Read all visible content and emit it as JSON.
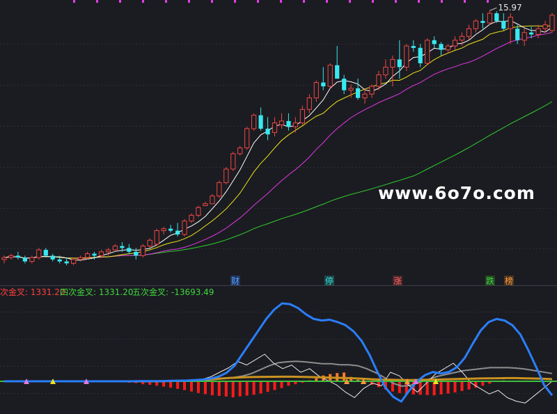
{
  "watermark": "www.6o7o.com",
  "price_panel": {
    "high_label": "15.97",
    "ma_colors": {
      "ma_short": "#ffffff",
      "ma_mid": "#f1e51a",
      "ma_long": "#e337e6",
      "ma_vlong": "#2fd12f"
    },
    "up_color": "#f24645",
    "down_color": "#38e8f0",
    "event_tags": [
      {
        "text": "财",
        "color": "#5aa0ff",
        "bg": "#20345a"
      },
      {
        "text": "停",
        "color": "#3ad8d8",
        "bg": "#1b4a4a"
      },
      {
        "text": "涨",
        "color": "#ff6a6a",
        "bg": "#4a2426"
      },
      {
        "text": "跌",
        "color": "#4bd44b",
        "bg": "#204420"
      },
      {
        "text": "榜",
        "color": "#ff9a3a",
        "bg": "#4a3420"
      }
    ]
  },
  "indicator_panel": {
    "legend": [
      {
        "text": "次金叉: 1331.20",
        "color": "#ff4040"
      },
      {
        "text": "四次金叉: 1331.20",
        "color": "#3fd83f"
      },
      {
        "text": "五次金叉: -13693.49",
        "color": "#3fd83f"
      }
    ]
  },
  "chart_data": {
    "type": "candlestick",
    "grid": true,
    "candles": [
      [
        9.5,
        9.6,
        9.4,
        9.55
      ],
      [
        9.55,
        9.65,
        9.5,
        9.6
      ],
      [
        9.6,
        9.7,
        9.5,
        9.55
      ],
      [
        9.55,
        9.6,
        9.4,
        9.45
      ],
      [
        9.45,
        9.6,
        9.4,
        9.55
      ],
      [
        9.55,
        9.8,
        9.5,
        9.75
      ],
      [
        9.75,
        9.8,
        9.55,
        9.6
      ],
      [
        9.6,
        9.65,
        9.45,
        9.5
      ],
      [
        9.5,
        9.6,
        9.4,
        9.45
      ],
      [
        9.45,
        9.55,
        9.35,
        9.4
      ],
      [
        9.4,
        9.55,
        9.35,
        9.5
      ],
      [
        9.5,
        9.6,
        9.45,
        9.55
      ],
      [
        9.55,
        9.7,
        9.5,
        9.65
      ],
      [
        9.65,
        9.7,
        9.5,
        9.6
      ],
      [
        9.6,
        9.75,
        9.55,
        9.7
      ],
      [
        9.7,
        9.8,
        9.6,
        9.75
      ],
      [
        9.75,
        9.9,
        9.7,
        9.85
      ],
      [
        9.85,
        9.95,
        9.7,
        9.8
      ],
      [
        9.8,
        9.9,
        9.65,
        9.7
      ],
      [
        9.7,
        9.8,
        9.5,
        9.6
      ],
      [
        9.6,
        9.9,
        9.55,
        9.85
      ],
      [
        9.85,
        10.05,
        9.8,
        10.0
      ],
      [
        9.9,
        10.3,
        9.85,
        10.25
      ],
      [
        10.25,
        10.35,
        10.15,
        10.3
      ],
      [
        10.3,
        10.4,
        10.2,
        10.25
      ],
      [
        10.25,
        10.45,
        10.1,
        10.15
      ],
      [
        10.15,
        10.55,
        10.1,
        10.5
      ],
      [
        10.5,
        10.7,
        10.45,
        10.65
      ],
      [
        10.65,
        10.9,
        10.6,
        10.85
      ],
      [
        10.9,
        11.0,
        10.9,
        10.95
      ],
      [
        10.95,
        11.2,
        10.95,
        11.15
      ],
      [
        11.15,
        11.55,
        11.1,
        11.5
      ],
      [
        11.5,
        11.9,
        11.45,
        11.85
      ],
      [
        11.85,
        12.3,
        11.8,
        12.25
      ],
      [
        12.25,
        12.45,
        12.2,
        12.4
      ],
      [
        12.4,
        12.95,
        12.35,
        12.9
      ],
      [
        12.9,
        13.3,
        12.85,
        13.25
      ],
      [
        13.25,
        13.45,
        12.85,
        12.9
      ],
      [
        12.9,
        13.2,
        12.6,
        12.75
      ],
      [
        12.8,
        13.2,
        12.7,
        13.05
      ],
      [
        13.0,
        13.3,
        12.9,
        13.1
      ],
      [
        13.1,
        13.3,
        12.85,
        12.95
      ],
      [
        12.95,
        13.2,
        12.8,
        13.05
      ],
      [
        13.05,
        13.5,
        13.0,
        13.4
      ],
      [
        13.4,
        13.8,
        13.3,
        13.7
      ],
      [
        13.7,
        14.15,
        13.6,
        14.1
      ],
      [
        14.1,
        14.5,
        13.9,
        14.0
      ],
      [
        14.0,
        14.6,
        13.95,
        14.55
      ],
      [
        14.55,
        15.05,
        14.5,
        14.2
      ],
      [
        14.2,
        14.3,
        13.8,
        13.9
      ],
      [
        13.9,
        14.05,
        13.7,
        13.95
      ],
      [
        13.95,
        14.2,
        13.65,
        13.7
      ],
      [
        13.7,
        13.95,
        13.55,
        13.8
      ],
      [
        13.8,
        14.05,
        13.7,
        14.0
      ],
      [
        14.0,
        14.4,
        13.9,
        14.3
      ],
      [
        14.3,
        14.7,
        14.2,
        14.5
      ],
      [
        14.5,
        14.8,
        14.0,
        14.7
      ],
      [
        14.7,
        15.2,
        14.2,
        14.5
      ],
      [
        14.5,
        15.1,
        14.4,
        15.05
      ],
      [
        15.05,
        15.2,
        14.9,
        15.0
      ],
      [
        15.0,
        15.1,
        14.5,
        14.6
      ],
      [
        14.6,
        15.25,
        14.55,
        15.2
      ],
      [
        15.2,
        15.3,
        15.0,
        15.1
      ],
      [
        15.1,
        15.15,
        14.8,
        14.95
      ],
      [
        14.95,
        15.1,
        14.85,
        15.05
      ],
      [
        15.05,
        15.3,
        14.95,
        15.2
      ],
      [
        15.2,
        15.4,
        15.05,
        15.3
      ],
      [
        15.3,
        15.6,
        15.2,
        15.5
      ],
      [
        15.5,
        15.75,
        15.4,
        15.7
      ],
      [
        15.7,
        15.9,
        15.5,
        15.65
      ],
      [
        15.65,
        15.97,
        15.6,
        15.9
      ],
      [
        15.9,
        15.95,
        15.65,
        15.7
      ],
      [
        15.7,
        15.9,
        15.45,
        15.5
      ],
      [
        15.5,
        15.9,
        15.1,
        15.8
      ],
      [
        15.5,
        15.6,
        15.1,
        15.2
      ],
      [
        15.2,
        15.5,
        15.05,
        15.4
      ],
      [
        15.4,
        15.55,
        15.25,
        15.35
      ],
      [
        15.35,
        15.6,
        15.25,
        15.5
      ],
      [
        15.5,
        15.7,
        15.4,
        15.6
      ],
      [
        15.45,
        15.9,
        15.4,
        15.85
      ]
    ],
    "indicator": {
      "blue": [
        0,
        0,
        0,
        0,
        0,
        0,
        0,
        0,
        0,
        0,
        0,
        0,
        0,
        0,
        0,
        0,
        0,
        0.2,
        0.3,
        0.2,
        0.3,
        0.6,
        0.8,
        1.0,
        1.5,
        2.2,
        3.5,
        6,
        11,
        20,
        35,
        50,
        65,
        80,
        92,
        100,
        99,
        94,
        86,
        80,
        78,
        79,
        76,
        72,
        64,
        52,
        34,
        12,
        -8,
        -20,
        -26,
        -12,
        0,
        8,
        12,
        10,
        12,
        18,
        30,
        48,
        65,
        76,
        80,
        78,
        72,
        60,
        40,
        18,
        -5,
        -18
      ],
      "gray": [
        0,
        0,
        0,
        0,
        0,
        0,
        0,
        0,
        0,
        0,
        0,
        0,
        0,
        0,
        0,
        0,
        0,
        0,
        0,
        0,
        0.2,
        0.4,
        0.8,
        1.2,
        2,
        3,
        4,
        5.5,
        8,
        12,
        16,
        19,
        20,
        20.5,
        20,
        19,
        18,
        18,
        17,
        17,
        16,
        13,
        9,
        4,
        -2,
        -5,
        -4,
        -1,
        2,
        5,
        7,
        9,
        11,
        12,
        13,
        14,
        14,
        14,
        13.5,
        12.5,
        11,
        9.5,
        8
      ],
      "orange": [
        0,
        0,
        0,
        0,
        0,
        0,
        0,
        0,
        0,
        0,
        0,
        0,
        0,
        0,
        0,
        0,
        0,
        0,
        0.2,
        0.4,
        0.6,
        1,
        1.5,
        2.5,
        3.2,
        4,
        4.5,
        5,
        5.2,
        5.3,
        5.4,
        5.5,
        5.5,
        5.3,
        5.1,
        4.8,
        4.5,
        4.2,
        3.9,
        3.5,
        3,
        2.4,
        2,
        1.8,
        1.6,
        1.5,
        1.6,
        1.8,
        2,
        2.3,
        2.6,
        2.9,
        3.2,
        3.4,
        3.6,
        3.7,
        3.8,
        3.8,
        3.6,
        3.3,
        3.0,
        2.6
      ],
      "white": [
        0,
        0,
        0,
        0,
        0,
        0,
        0,
        0,
        0,
        0,
        0,
        0,
        0,
        0,
        0,
        0,
        0,
        0,
        0.1,
        0.2,
        0.1,
        0.5,
        2,
        5,
        10,
        15,
        22,
        18,
        24,
        30,
        20,
        14,
        18,
        10,
        14,
        6,
        1,
        -4,
        -12,
        -18,
        -8,
        -2,
        -5,
        10,
        6,
        -4,
        -12,
        -2,
        8,
        14,
        20,
        10,
        -2,
        -8,
        -14,
        -10,
        -18,
        -22,
        -24,
        -16,
        -8,
        0
      ],
      "bars": [
        0,
        0,
        0,
        0,
        0,
        0,
        0,
        0,
        0,
        0,
        0,
        0,
        0,
        0,
        0,
        0,
        0,
        0,
        -0.5,
        -0.6,
        -1,
        -1.2,
        -1.5,
        -1.8,
        -2.2,
        -2.6,
        -3,
        -3.5,
        -4,
        -4.4,
        -4.8,
        -5,
        -5.2,
        -5.5,
        -5.2,
        -4.9,
        -4.6,
        -4.2,
        -3.6,
        -3,
        -2.3,
        -1.5,
        -1,
        -0.5,
        0.3,
        1,
        2,
        2.5,
        2.8,
        3,
        1.5,
        0.5,
        -0.5,
        -1.2,
        -2,
        -2.8,
        -3.5,
        -4,
        -4.3,
        -4.5,
        -4.6,
        -4.7,
        -4.8,
        -4.5,
        -4.2,
        -3.8,
        -3.3,
        -2.8,
        -2.2,
        -1.5,
        -0.8,
        -0.2,
        0.3
      ]
    }
  }
}
